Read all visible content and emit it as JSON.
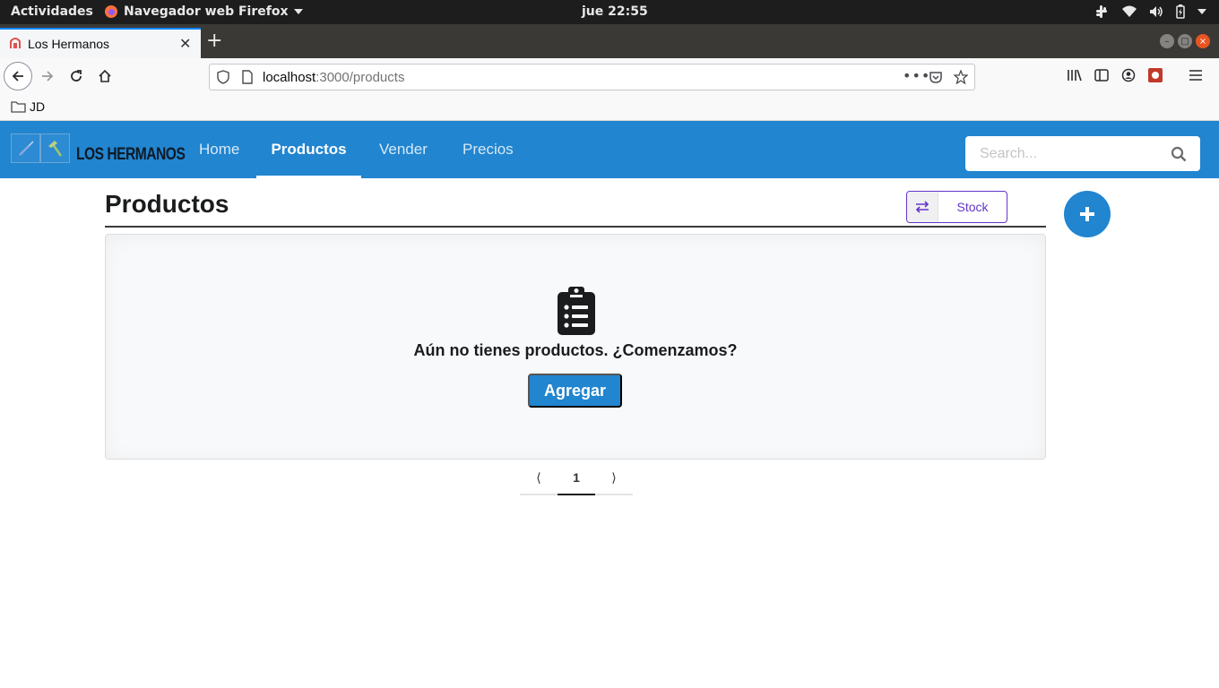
{
  "system_bar": {
    "activities": "Actividades",
    "app_menu": "Navegador web Firefox",
    "clock": "jue 22:55"
  },
  "browser": {
    "tab_title": "Los Hermanos",
    "url_host": "localhost",
    "url_path": ":3000/products",
    "bookmark": "JD"
  },
  "app": {
    "brand": "LOS HERMANOS",
    "nav": [
      {
        "label": "Home",
        "active": false
      },
      {
        "label": "Productos",
        "active": true
      },
      {
        "label": "Vender",
        "active": false
      },
      {
        "label": "Precios",
        "active": false
      }
    ],
    "search_placeholder": "Search...",
    "accent_color": "#2185d0",
    "secondary_color": "#6435c9"
  },
  "main": {
    "title": "Productos",
    "stock_button": "Stock",
    "empty_message": "Aún no tienes productos. ¿Comenzamos?",
    "add_button": "Agregar",
    "pagination": {
      "prev": "⟨",
      "current": "1",
      "next": "⟩"
    }
  }
}
